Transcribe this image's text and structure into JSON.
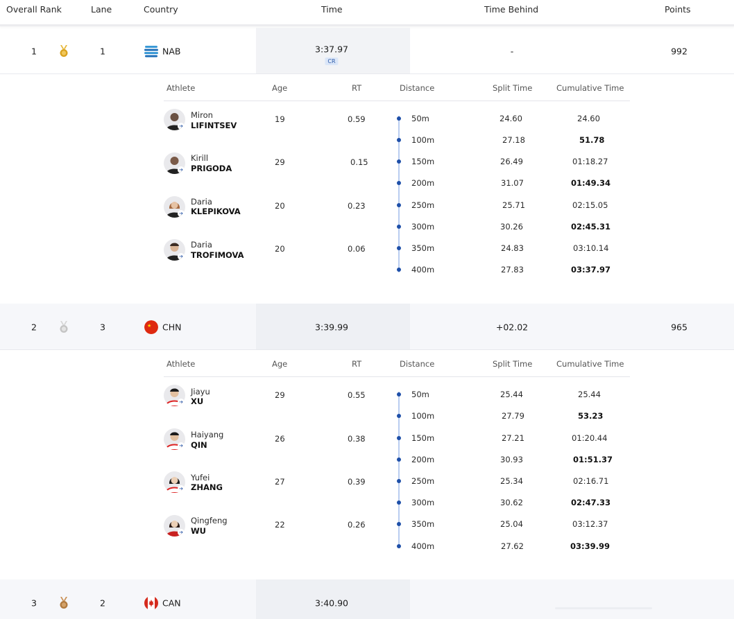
{
  "header": {
    "overall_rank": "Overall Rank",
    "lane": "Lane",
    "country": "Country",
    "time": "Time",
    "time_behind": "Time Behind",
    "points": "Points"
  },
  "detail_headers": {
    "athlete": "Athlete",
    "age": "Age",
    "rt": "RT",
    "distance": "Distance",
    "split_time": "Split Time",
    "cumulative_time": "Cumulative Time"
  },
  "teams": [
    {
      "rank": "1",
      "medal": "gold-medal-icon",
      "lane": "1",
      "country": "NAB",
      "time": "3:37.97",
      "record": "CR",
      "time_behind": "-",
      "points": "992",
      "athletes": [
        {
          "first": "Miron",
          "last": "LIFINTSEV",
          "age": "19",
          "rt": "0.59"
        },
        {
          "first": "Kirill",
          "last": "PRIGODA",
          "age": "29",
          "rt": "0.15"
        },
        {
          "first": "Daria",
          "last": "KLEPIKOVA",
          "age": "20",
          "rt": "0.23"
        },
        {
          "first": "Daria",
          "last": "TROFIMOVA",
          "age": "20",
          "rt": "0.06"
        }
      ],
      "splits": [
        {
          "distance": "50m",
          "split": "24.60",
          "cumulative": "24.60"
        },
        {
          "distance": "100m",
          "split": "27.18",
          "cumulative": "51.78"
        },
        {
          "distance": "150m",
          "split": "26.49",
          "cumulative": "01:18.27"
        },
        {
          "distance": "200m",
          "split": "31.07",
          "cumulative": "01:49.34"
        },
        {
          "distance": "250m",
          "split": "25.71",
          "cumulative": "02:15.05"
        },
        {
          "distance": "300m",
          "split": "30.26",
          "cumulative": "02:45.31"
        },
        {
          "distance": "350m",
          "split": "24.83",
          "cumulative": "03:10.14"
        },
        {
          "distance": "400m",
          "split": "27.83",
          "cumulative": "03:37.97"
        }
      ]
    },
    {
      "rank": "2",
      "medal": "silver-medal-icon",
      "lane": "3",
      "country": "CHN",
      "time": "3:39.99",
      "time_behind": "+02.02",
      "points": "965",
      "athletes": [
        {
          "first": "Jiayu",
          "last": "XU",
          "age": "29",
          "rt": "0.55"
        },
        {
          "first": "Haiyang",
          "last": "QIN",
          "age": "26",
          "rt": "0.38"
        },
        {
          "first": "Yufei",
          "last": "ZHANG",
          "age": "27",
          "rt": "0.39"
        },
        {
          "first": "Qingfeng",
          "last": "WU",
          "age": "22",
          "rt": "0.26"
        }
      ],
      "splits": [
        {
          "distance": "50m",
          "split": "25.44",
          "cumulative": "25.44"
        },
        {
          "distance": "100m",
          "split": "27.79",
          "cumulative": "53.23"
        },
        {
          "distance": "150m",
          "split": "27.21",
          "cumulative": "01:20.44"
        },
        {
          "distance": "200m",
          "split": "30.93",
          "cumulative": "01:51.37"
        },
        {
          "distance": "250m",
          "split": "25.34",
          "cumulative": "02:16.71"
        },
        {
          "distance": "300m",
          "split": "30.62",
          "cumulative": "02:47.33"
        },
        {
          "distance": "350m",
          "split": "25.04",
          "cumulative": "03:12.37"
        },
        {
          "distance": "400m",
          "split": "27.62",
          "cumulative": "03:39.99"
        }
      ]
    },
    {
      "rank": "3",
      "medal": "bronze-medal-icon",
      "lane": "2",
      "country": "CAN",
      "time": "3:40.90"
    }
  ],
  "colors": {
    "gold": "#d9a21f",
    "silver": "#c4c4c4",
    "bronze": "#b07a3e",
    "accent": "#1e4fa8"
  }
}
